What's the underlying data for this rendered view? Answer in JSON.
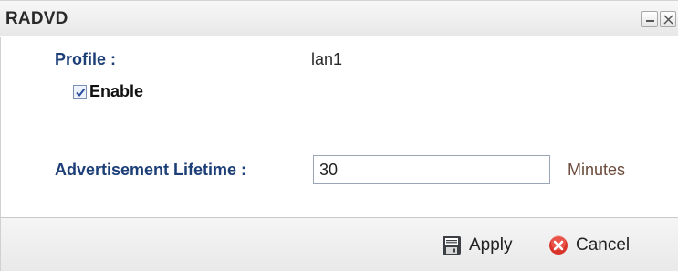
{
  "window": {
    "title": "RADVD",
    "minimize_icon": "minimize-icon",
    "close_icon": "close-icon"
  },
  "form": {
    "profile_label": "Profile :",
    "profile_value": "lan1",
    "enable_label": "Enable",
    "enable_checked": true,
    "lifetime_label": "Advertisement Lifetime :",
    "lifetime_value": "30",
    "lifetime_unit": "Minutes"
  },
  "footer": {
    "apply_label": "Apply",
    "apply_icon": "save-icon",
    "cancel_label": "Cancel",
    "cancel_icon": "cancel-icon"
  },
  "colors": {
    "label_blue": "#1d3f78",
    "unit_brown": "#6b4a3a",
    "cancel_red": "#d9342b"
  }
}
